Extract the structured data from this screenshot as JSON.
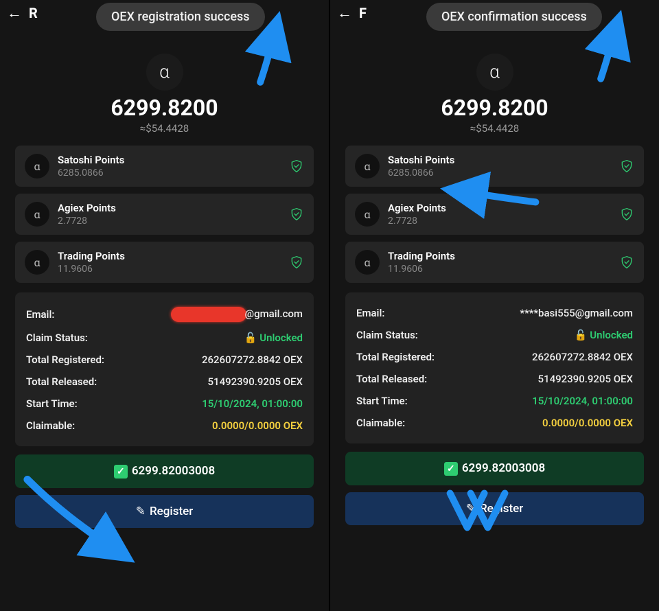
{
  "left": {
    "toast": "OEX registration success",
    "peek_title": "R",
    "balance": "6299.8200",
    "balance_usd": "≈$54.4428",
    "logo_glyph": "α",
    "points": [
      {
        "title": "Satoshi Points",
        "value": "6285.0866"
      },
      {
        "title": "Agiex Points",
        "value": "2.7728"
      },
      {
        "title": "Trading Points",
        "value": "11.9606"
      }
    ],
    "detail": {
      "email_label": "Email:",
      "email_suffix": "@gmail.com",
      "claim_label": "Claim Status:",
      "claim_value": "Unlocked",
      "totalreg_label": "Total Registered:",
      "totalreg_value": "262607272.8842 OEX",
      "totalrel_label": "Total Released:",
      "totalrel_value": "51492390.9205 OEX",
      "start_label": "Start Time:",
      "start_value": "15/10/2024, 01:00:00",
      "claimable_label": "Claimable:",
      "claimable_value": "0.0000/0.0000 OEX"
    },
    "confirm_amount": "6299.82003008",
    "register_label": "Register"
  },
  "right": {
    "toast": "OEX confirmation success",
    "peek_title": "F",
    "balance": "6299.8200",
    "balance_usd": "≈$54.4428",
    "logo_glyph": "α",
    "points": [
      {
        "title": "Satoshi Points",
        "value": "6285.0866"
      },
      {
        "title": "Agiex Points",
        "value": "2.7728"
      },
      {
        "title": "Trading Points",
        "value": "11.9606"
      }
    ],
    "detail": {
      "email_label": "Email:",
      "email_value": "****basi555@gmail.com",
      "claim_label": "Claim Status:",
      "claim_value": "Unlocked",
      "totalreg_label": "Total Registered:",
      "totalreg_value": "262607272.8842 OEX",
      "totalrel_label": "Total Released:",
      "totalrel_value": "51492390.9205 OEX",
      "start_label": "Start Time:",
      "start_value": "15/10/2024, 01:00:00",
      "claimable_label": "Claimable:",
      "claimable_value": "0.0000/0.0000 OEX"
    },
    "confirm_amount": "6299.82003008",
    "register_label": "Register"
  },
  "colors": {
    "annotation_arrow": "#1f8ef1"
  }
}
